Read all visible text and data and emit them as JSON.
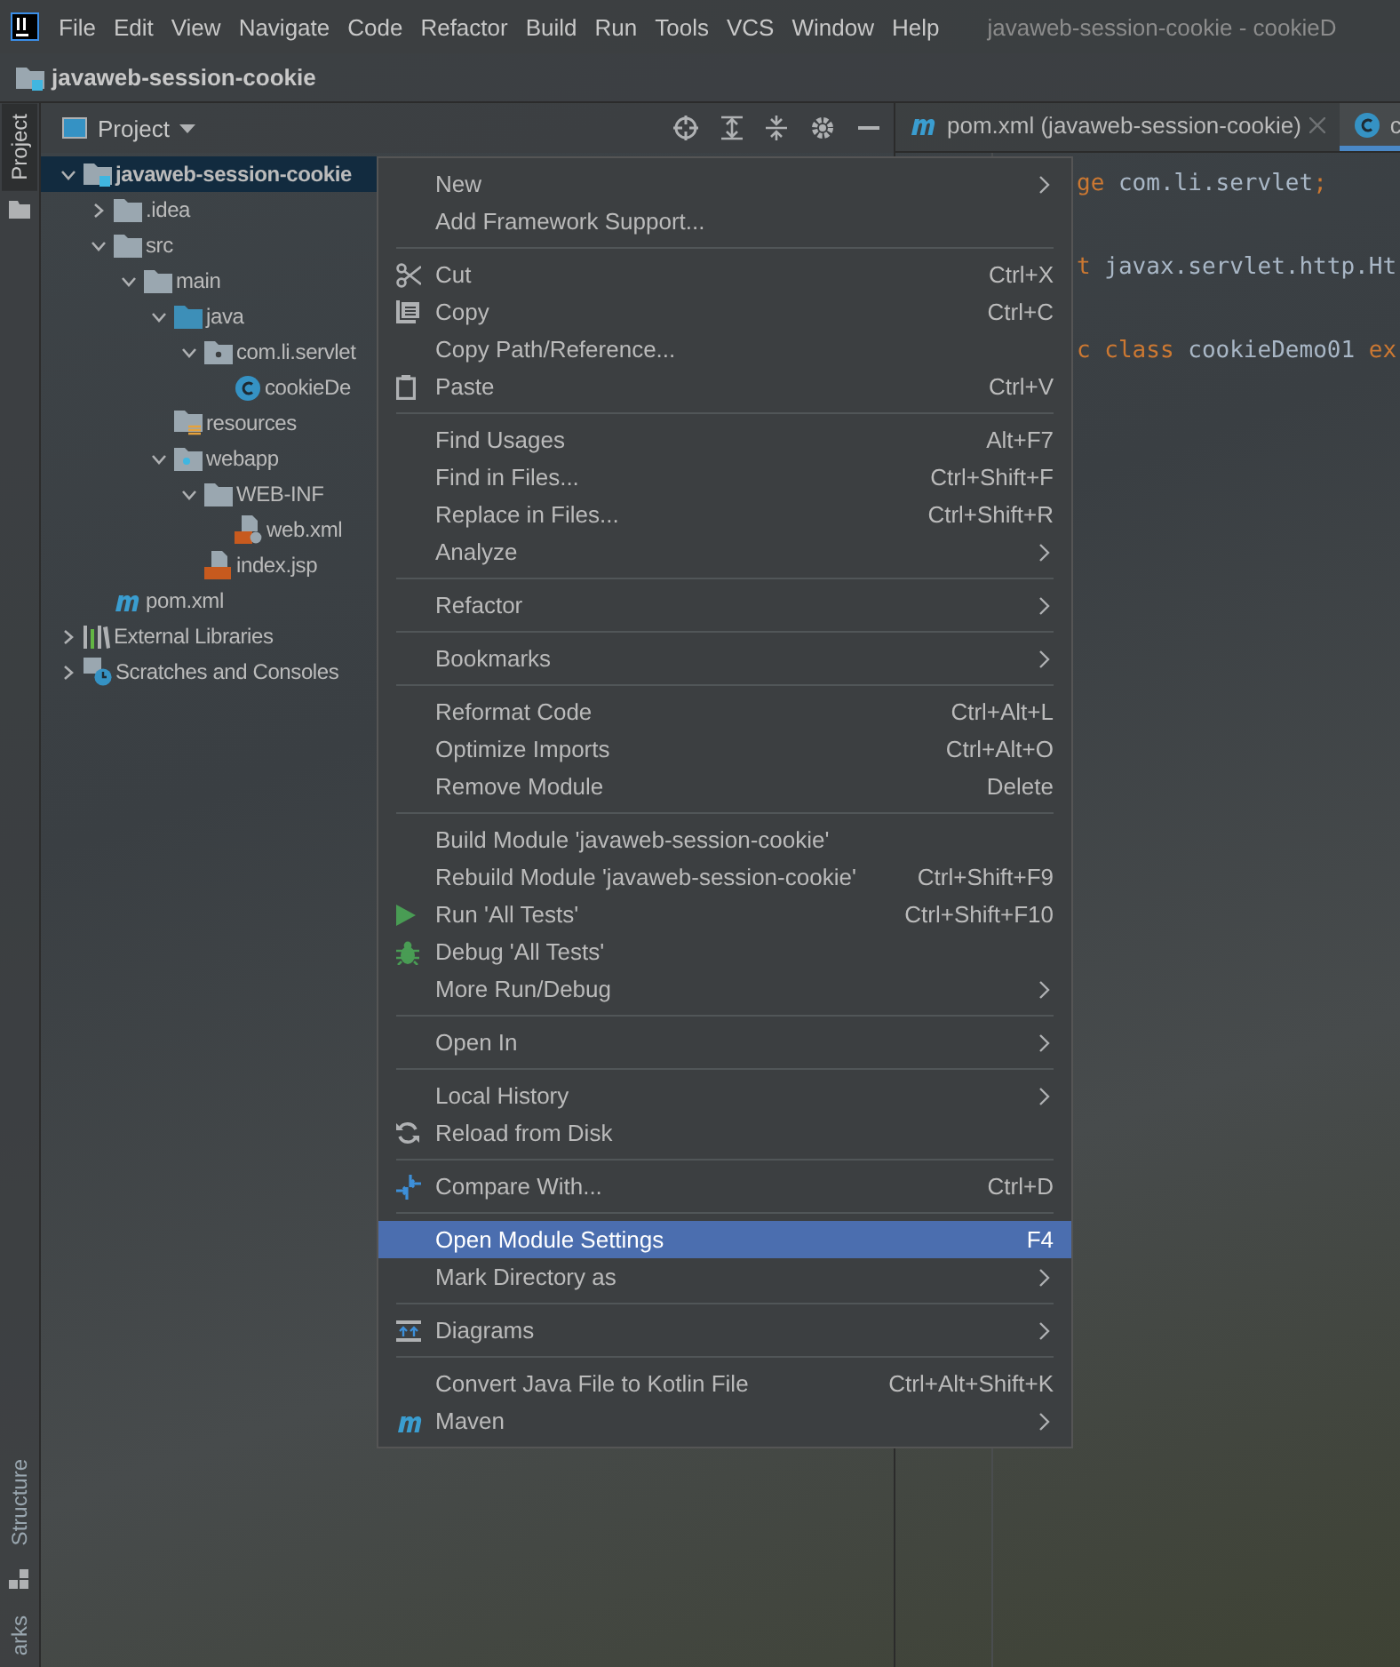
{
  "menu_bar": {
    "items": [
      "File",
      "Edit",
      "View",
      "Navigate",
      "Code",
      "Refactor",
      "Build",
      "Run",
      "Tools",
      "VCS",
      "Window",
      "Help"
    ]
  },
  "window": {
    "title": "javaweb-session-cookie - cookieD"
  },
  "navigation_bar": {
    "path": "javaweb-session-cookie"
  },
  "side_stripe": {
    "top": [
      {
        "label": "Project",
        "selected": true
      }
    ],
    "bottom": [
      {
        "label": "Structure",
        "selected": false
      },
      {
        "label": "arks",
        "selected": false
      }
    ]
  },
  "project_panel": {
    "title": "Project",
    "tree": [
      {
        "label": "javaweb-session-cookie",
        "kind": "module",
        "expanded": true,
        "selected": true,
        "children": [
          {
            "label": ".idea",
            "kind": "folder",
            "expanded": false,
            "selected": false
          },
          {
            "label": "src",
            "kind": "folder",
            "expanded": true,
            "selected": false,
            "children": [
              {
                "label": "main",
                "kind": "folder",
                "expanded": true,
                "selected": false,
                "children": [
                  {
                    "label": "java",
                    "kind": "source",
                    "expanded": true,
                    "selected": false,
                    "children": [
                      {
                        "label": "com.li.servlet",
                        "kind": "package",
                        "expanded": true,
                        "selected": false,
                        "children": [
                          {
                            "label": "cookieDe",
                            "kind": "class",
                            "selected": false
                          }
                        ]
                      }
                    ]
                  },
                  {
                    "label": "resources",
                    "kind": "resources",
                    "selected": false
                  },
                  {
                    "label": "webapp",
                    "kind": "web",
                    "expanded": true,
                    "selected": false,
                    "children": [
                      {
                        "label": "WEB-INF",
                        "kind": "folder",
                        "expanded": true,
                        "selected": false,
                        "children": [
                          {
                            "label": "web.xml",
                            "kind": "xml",
                            "selected": false
                          }
                        ]
                      },
                      {
                        "label": "index.jsp",
                        "kind": "jsp",
                        "selected": false
                      }
                    ]
                  }
                ]
              }
            ]
          },
          {
            "label": "pom.xml",
            "kind": "maven",
            "selected": false
          }
        ]
      },
      {
        "label": "External Libraries",
        "kind": "libraries",
        "expanded": false,
        "selected": false
      },
      {
        "label": "Scratches and Consoles",
        "kind": "scratches",
        "expanded": false,
        "selected": false
      }
    ]
  },
  "editor": {
    "tabs": [
      {
        "label": "pom.xml (javaweb-session-cookie)",
        "kind": "maven",
        "selected": false
      },
      {
        "label": "c",
        "kind": "class",
        "selected": true
      }
    ],
    "lines": [
      [
        {
          "text": "ge",
          "kind": "keyword"
        },
        {
          "text": " com.li.servlet",
          "kind": "plain"
        },
        {
          "text": ";",
          "kind": "keyword"
        }
      ],
      [
        {
          "text": "t",
          "kind": "keyword"
        },
        {
          "text": " javax.servlet.http.Ht",
          "kind": "plain"
        }
      ],
      [
        {
          "text": "c class",
          "kind": "keyword"
        },
        {
          "text": " cookieDemo01 ",
          "kind": "plain"
        },
        {
          "text": "ex",
          "kind": "keyword"
        }
      ]
    ]
  },
  "context_menu": {
    "groups": [
      [
        {
          "label": "New",
          "kind": "plain",
          "submenu": true,
          "selected": false
        },
        {
          "label": "Add Framework Support...",
          "kind": "plain",
          "submenu": false,
          "selected": false
        }
      ],
      [
        {
          "label": "Cut",
          "kind": "cut",
          "shortcut": "Ctrl+X",
          "submenu": false,
          "selected": false
        },
        {
          "label": "Copy",
          "kind": "copy",
          "shortcut": "Ctrl+C",
          "submenu": false,
          "selected": false
        },
        {
          "label": "Copy Path/Reference...",
          "kind": "plain",
          "submenu": false,
          "selected": false
        },
        {
          "label": "Paste",
          "kind": "paste",
          "shortcut": "Ctrl+V",
          "submenu": false,
          "selected": false
        }
      ],
      [
        {
          "label": "Find Usages",
          "kind": "plain",
          "shortcut": "Alt+F7",
          "submenu": false,
          "selected": false
        },
        {
          "label": "Find in Files...",
          "kind": "plain",
          "shortcut": "Ctrl+Shift+F",
          "submenu": false,
          "selected": false
        },
        {
          "label": "Replace in Files...",
          "kind": "plain",
          "shortcut": "Ctrl+Shift+R",
          "submenu": false,
          "selected": false
        },
        {
          "label": "Analyze",
          "kind": "plain",
          "submenu": true,
          "selected": false
        }
      ],
      [
        {
          "label": "Refactor",
          "kind": "plain",
          "submenu": true,
          "selected": false
        }
      ],
      [
        {
          "label": "Bookmarks",
          "kind": "plain",
          "submenu": true,
          "selected": false
        }
      ],
      [
        {
          "label": "Reformat Code",
          "kind": "plain",
          "shortcut": "Ctrl+Alt+L",
          "submenu": false,
          "selected": false
        },
        {
          "label": "Optimize Imports",
          "kind": "plain",
          "shortcut": "Ctrl+Alt+O",
          "submenu": false,
          "selected": false
        },
        {
          "label": "Remove Module",
          "kind": "plain",
          "shortcut": "Delete",
          "submenu": false,
          "selected": false
        }
      ],
      [
        {
          "label": "Build Module 'javaweb-session-cookie'",
          "kind": "plain",
          "submenu": false,
          "selected": false
        },
        {
          "label": "Rebuild Module 'javaweb-session-cookie'",
          "kind": "plain",
          "shortcut": "Ctrl+Shift+F9",
          "submenu": false,
          "selected": false
        },
        {
          "label": "Run 'All Tests'",
          "kind": "run",
          "shortcut": "Ctrl+Shift+F10",
          "submenu": false,
          "selected": false
        },
        {
          "label": "Debug 'All Tests'",
          "kind": "debug",
          "submenu": false,
          "selected": false
        },
        {
          "label": "More Run/Debug",
          "kind": "plain",
          "submenu": true,
          "selected": false
        }
      ],
      [
        {
          "label": "Open In",
          "kind": "plain",
          "submenu": true,
          "selected": false
        }
      ],
      [
        {
          "label": "Local History",
          "kind": "plain",
          "submenu": true,
          "selected": false
        },
        {
          "label": "Reload from Disk",
          "kind": "reload",
          "submenu": false,
          "selected": false
        }
      ],
      [
        {
          "label": "Compare With...",
          "kind": "compare",
          "shortcut": "Ctrl+D",
          "submenu": false,
          "selected": false
        }
      ],
      [
        {
          "label": "Open Module Settings",
          "kind": "plain",
          "shortcut": "F4",
          "submenu": false,
          "selected": true
        },
        {
          "label": "Mark Directory as",
          "kind": "plain",
          "submenu": true,
          "selected": false
        }
      ],
      [
        {
          "label": "Diagrams",
          "kind": "diagrams",
          "submenu": true,
          "selected": false
        }
      ],
      [
        {
          "label": "Convert Java File to Kotlin File",
          "kind": "plain",
          "shortcut": "Ctrl+Alt+Shift+K",
          "submenu": false,
          "selected": false
        },
        {
          "label": "Maven",
          "kind": "maven",
          "submenu": true,
          "selected": false
        }
      ]
    ]
  }
}
